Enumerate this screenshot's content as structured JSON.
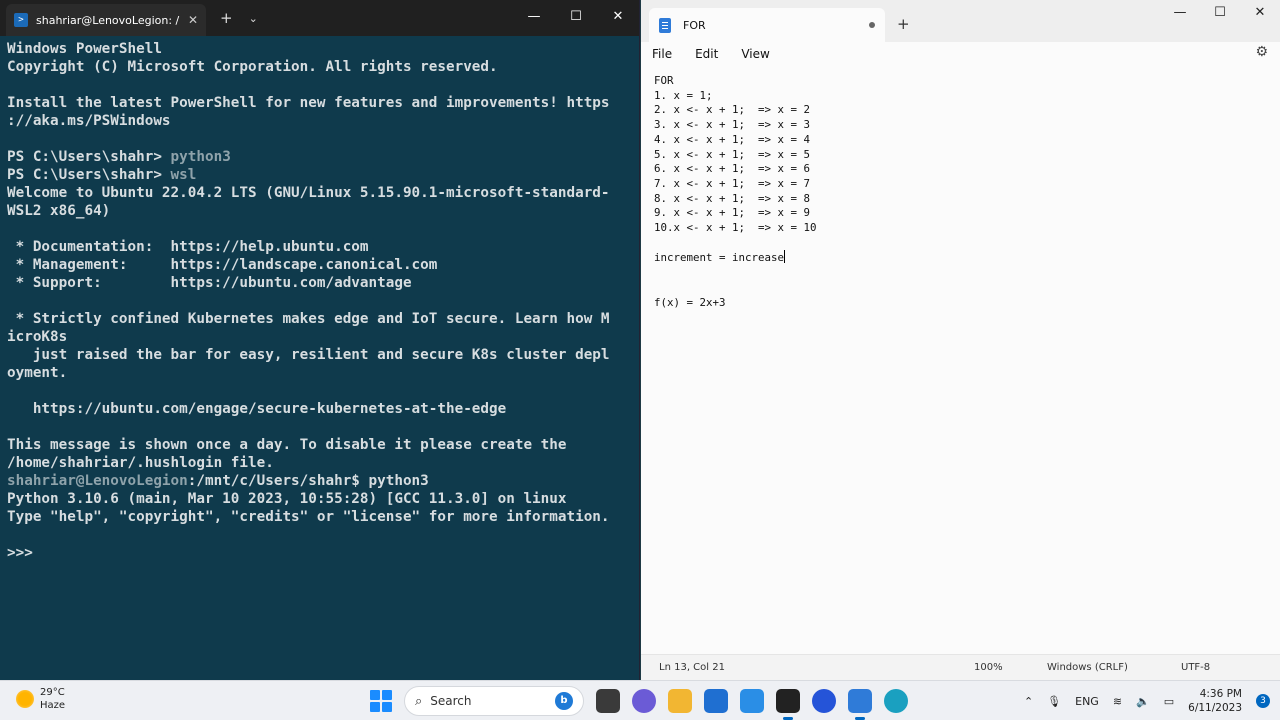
{
  "terminal": {
    "tab_title": "shahriar@LenovoLegion: /mn",
    "tab_close": "✕",
    "new_tab": "+",
    "dropdown": "⌄",
    "minimize": "—",
    "maximize": "☐",
    "close": "✕",
    "lines": [
      {
        "text": "Windows PowerShell"
      },
      {
        "text": "Copyright (C) Microsoft Corporation. All rights reserved."
      },
      {
        "text": ""
      },
      {
        "text": "Install the latest PowerShell for new features and improvements! https"
      },
      {
        "text": "://aka.ms/PSWindows"
      },
      {
        "text": ""
      },
      {
        "text": "PS C:\\Users\\shahr> ",
        "dim": "python3"
      },
      {
        "text": "PS C:\\Users\\shahr> ",
        "dim": "wsl"
      },
      {
        "text": "Welcome to Ubuntu 22.04.2 LTS (GNU/Linux 5.15.90.1-microsoft-standard-"
      },
      {
        "text": "WSL2 x86_64)"
      },
      {
        "text": ""
      },
      {
        "text": " * Documentation:  https://help.ubuntu.com"
      },
      {
        "text": " * Management:     https://landscape.canonical.com"
      },
      {
        "text": " * Support:        https://ubuntu.com/advantage"
      },
      {
        "text": ""
      },
      {
        "text": " * Strictly confined Kubernetes makes edge and IoT secure. Learn how M"
      },
      {
        "text": "icroK8s"
      },
      {
        "text": "   just raised the bar for easy, resilient and secure K8s cluster depl"
      },
      {
        "text": "oyment."
      },
      {
        "text": ""
      },
      {
        "text": "   https://ubuntu.com/engage/secure-kubernetes-at-the-edge"
      },
      {
        "text": ""
      },
      {
        "text": "This message is shown once a day. To disable it please create the"
      },
      {
        "text": "/home/shahriar/.hushlogin file."
      },
      {
        "dim_prefix": "shahriar@LenovoLegion",
        "text": ":/mnt/c/Users/shahr$ python3"
      },
      {
        "text": "Python 3.10.6 (main, Mar 10 2023, 10:55:28) [GCC 11.3.0] on linux"
      },
      {
        "text": "Type \"help\", \"copyright\", \"credits\" or \"license\" for more information."
      },
      {
        "text": ""
      },
      {
        "text": ">>> "
      }
    ]
  },
  "notepad": {
    "tab_title": "FOR",
    "new_tab": "+",
    "minimize": "—",
    "maximize": "☐",
    "close": "✕",
    "menu": {
      "file": "File",
      "edit": "Edit",
      "view": "View"
    },
    "settings_icon": "⚙",
    "content_lines": [
      "FOR",
      "1. x = 1;",
      "2. x <- x + 1;  => x = 2",
      "3. x <- x + 1;  => x = 3",
      "4. x <- x + 1;  => x = 4",
      "5. x <- x + 1;  => x = 5",
      "6. x <- x + 1;  => x = 6",
      "7. x <- x + 1;  => x = 7",
      "8. x <- x + 1;  => x = 8",
      "9. x <- x + 1;  => x = 9",
      "10.x <- x + 1;  => x = 10",
      "",
      "increment = increase",
      "",
      "",
      "f(x) = 2x+3"
    ],
    "status": {
      "position": "Ln 13, Col 21",
      "zoom": "100%",
      "line_ending": "Windows (CRLF)",
      "encoding": "UTF-8"
    }
  },
  "taskbar": {
    "weather_temp": "29°C",
    "weather_desc": "Haze",
    "search_label": "Search",
    "bing_label": "b",
    "language": "ENG",
    "time": "4:36 PM",
    "date": "6/11/2023",
    "notification_count": "3",
    "chevron": "⌃"
  }
}
